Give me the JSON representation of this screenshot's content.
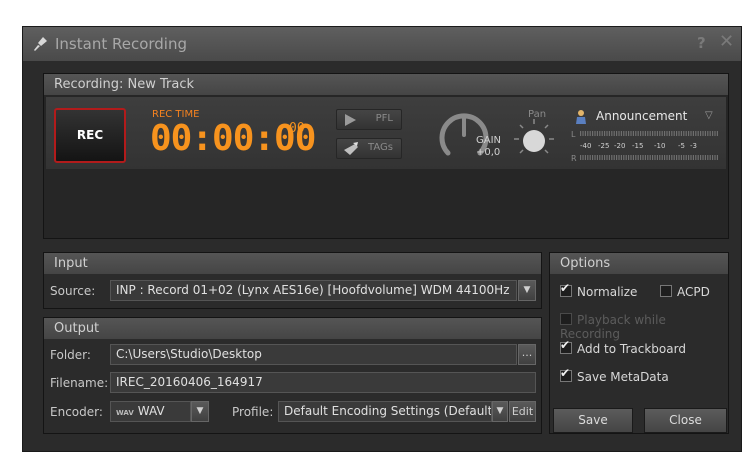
{
  "window": {
    "title": "Instant Recording",
    "help_glyph": "?",
    "close_glyph": "✕"
  },
  "recorder": {
    "header": "Recording: New Track",
    "rec_label": "REC",
    "rec_time_label": "REC TIME",
    "rec_time": "00:00:00",
    "rec_frames": "00",
    "pfl_label": "PFL",
    "tags_label": "TAGs",
    "gain_label": "GAIN",
    "gain_value": "+0,0",
    "pan_label": "Pan",
    "speaker_name": "Announcement",
    "meter": {
      "left_channel": "L",
      "right_channel": "R",
      "scale": [
        "-40",
        "-25",
        "-20",
        "-15",
        "-10",
        "-5",
        "-3"
      ]
    }
  },
  "input": {
    "header": "Input",
    "source_label": "Source:",
    "source_value": "INP  : Record 01+02 (Lynx AES16e) [Hoofdvolume] WDM 44100Hz"
  },
  "output": {
    "header": "Output",
    "folder_label": "Folder:",
    "folder_value": "C:\\Users\\Studio\\Desktop",
    "folder_browse": "...",
    "filename_label": "Filename:",
    "filename_value": "IREC_20160406_164917",
    "encoder_label": "Encoder:",
    "encoder_badge": "WAV",
    "encoder_value": "WAV",
    "profile_label": "Profile:",
    "profile_value": "Default Encoding Settings (Default...",
    "edit_label": "Edit"
  },
  "options": {
    "header": "Options",
    "normalize": {
      "label": "Normalize",
      "checked": true
    },
    "acpd": {
      "label": "ACPD",
      "checked": false
    },
    "playback": {
      "label": "Playback while Recording",
      "checked": false,
      "disabled": true
    },
    "add_to_trackboard": {
      "label": "Add to Trackboard",
      "checked": true
    },
    "save_metadata": {
      "label": "Save MetaData",
      "checked": true
    }
  },
  "footer": {
    "save_label": "Save",
    "close_label": "Close"
  },
  "colors": {
    "rec_time": "#f7931e",
    "rec_border": "#b21b1b",
    "window_bg": "#2b2b2b"
  }
}
